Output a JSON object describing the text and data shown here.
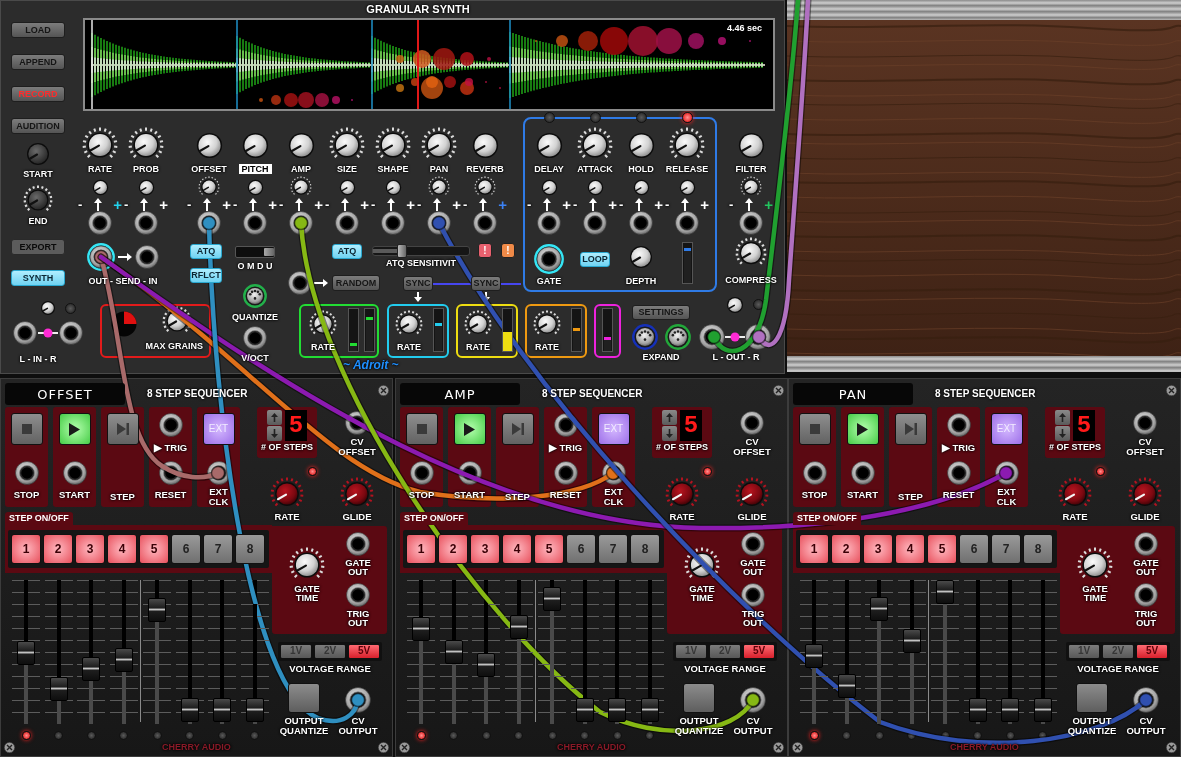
{
  "granular_synth": {
    "title": "GRANULAR SYNTH",
    "side_buttons": [
      {
        "label": "LOAD",
        "kind": "normal"
      },
      {
        "label": "APPEND",
        "kind": "normal"
      },
      {
        "label": "RECORD",
        "kind": "record"
      },
      {
        "label": "AUDITION",
        "kind": "normal"
      }
    ],
    "start_knob": {
      "label": "START"
    },
    "end_knob": {
      "label": "END"
    },
    "export_button": {
      "label": "EXPORT",
      "disabled": true
    },
    "synth_button": {
      "label": "SYNTH",
      "on": true
    },
    "input": {
      "label": "L - IN - R",
      "led": {
        "on": false
      }
    },
    "display": {
      "duration": "4.46 sec"
    },
    "params": [
      {
        "label": "RATE",
        "modulated": true,
        "highlighted": false,
        "cv": {
          "minus": "-",
          "plus": "+",
          "modulated": false,
          "color": "#22d3ee"
        }
      },
      {
        "label": "PROB",
        "modulated": true,
        "highlighted": false,
        "cv": {
          "minus": "-",
          "plus": "+",
          "modulated": false
        }
      },
      {
        "label": "OFFSET",
        "modulated": false,
        "highlighted": false,
        "cv": {
          "minus": "-",
          "plus": "+",
          "modulated": true
        }
      },
      {
        "label": "PITCH",
        "modulated": false,
        "highlighted": true,
        "cv": {
          "minus": "-",
          "plus": "+",
          "modulated": false
        }
      },
      {
        "label": "AMP",
        "modulated": false,
        "highlighted": false,
        "cv": {
          "minus": "-",
          "plus": "+",
          "modulated": true
        }
      },
      {
        "label": "SIZE",
        "modulated": true,
        "highlighted": false,
        "cv": {
          "minus": "-",
          "plus": "+",
          "modulated": false
        }
      },
      {
        "label": "SHAPE",
        "modulated": true,
        "highlighted": false,
        "cv": {
          "minus": "-",
          "plus": "+",
          "modulated": false
        }
      },
      {
        "label": "PAN",
        "modulated": true,
        "highlighted": false,
        "cv": {
          "minus": "-",
          "plus": "+",
          "modulated": true
        }
      },
      {
        "label": "REVERB",
        "modulated": false,
        "highlighted": false,
        "cv": {
          "minus": "-",
          "plus": "+",
          "modulated": true,
          "color": "#3b82f6"
        }
      }
    ],
    "envelope": {
      "stages": [
        {
          "label": "DELAY",
          "modulated": false,
          "highlighted": false,
          "active": false,
          "cv": {
            "minus": "-",
            "plus": "+",
            "modulated": false
          }
        },
        {
          "label": "ATTACK",
          "modulated": true,
          "highlighted": false,
          "active": false,
          "cv": {
            "minus": "-",
            "plus": "+",
            "modulated": false
          }
        },
        {
          "label": "HOLD",
          "modulated": false,
          "highlighted": false,
          "active": false,
          "cv": {
            "minus": "-",
            "plus": "+",
            "modulated": false
          }
        },
        {
          "label": "RELEASE",
          "modulated": true,
          "highlighted": false,
          "active": true,
          "cv": {
            "minus": "-",
            "plus": "+",
            "modulated": false
          }
        }
      ],
      "gate": {
        "label": "GATE",
        "active": true
      },
      "loop": {
        "label": "LOOP",
        "on": true
      },
      "depth": {
        "label": "DEPTH"
      },
      "meter": {
        "level": 0.85
      }
    },
    "filter": {
      "label": "FILTER",
      "modulated": false,
      "highlighted": false,
      "cv": {
        "minus": "-",
        "plus": "+",
        "modulated": true,
        "color": "#22c55e"
      }
    },
    "compress": {
      "label": "COMPRESS",
      "modulated": true
    },
    "send": {
      "label": "OUT - SEND - IN",
      "active": true
    },
    "atq_buttons": [
      {
        "label": "ATQ",
        "on": true
      },
      {
        "label": "RFLCT",
        "on": true
      }
    ],
    "mode_switch": {
      "label": "O M D U",
      "level": 1
    },
    "atq_toggle": {
      "label": "ATQ",
      "on": true
    },
    "atq_sensitivity": {
      "label": "ATQ SENSITIVIT",
      "level": 0.25
    },
    "alerts": [
      {
        "label": "!",
        "color": "#e8606e"
      },
      {
        "label": "!",
        "color": "#f08a48"
      }
    ],
    "random": {
      "label": "RANDOM"
    },
    "sync_buttons": [
      {
        "label": "SYNC"
      },
      {
        "label": "SYNC"
      }
    ],
    "max_grains": {
      "label": "MAX GRAINS",
      "knob": {
        "modulated": true
      }
    },
    "quantize": {
      "label": "QUANTIZE",
      "color": "#22b04a"
    },
    "voct": {
      "label": "V/OCT"
    },
    "lfos": [
      {
        "color": "#22dd33",
        "label": "RATE",
        "meters": [
          {
            "kind": "marker",
            "level": 0.2
          },
          {
            "kind": "marker",
            "level": 0.8
          }
        ]
      },
      {
        "color": "#22ccee",
        "label": "RATE",
        "meters": [
          {
            "kind": "marker",
            "level": 0.65
          }
        ]
      },
      {
        "color": "#eedd11",
        "label": "RATE",
        "meters": [
          {
            "kind": "fill",
            "level": 0.45
          }
        ]
      },
      {
        "color": "#ee9911",
        "label": "RATE",
        "meters": [
          {
            "kind": "marker",
            "level": 0.55
          }
        ]
      },
      {
        "color": "#ee22dd",
        "meters": [
          {
            "kind": "marker",
            "level": 0.35
          }
        ]
      }
    ],
    "brand": "~ Adroit ~",
    "settings": {
      "label": "SETTINGS"
    },
    "expand": {
      "label": "EXPAND",
      "ports": [
        {
          "color": "#1530b8"
        },
        {
          "color": "#22a83a"
        }
      ]
    },
    "output": {
      "label": "L - OUT - R",
      "led": {
        "on": false
      }
    }
  },
  "sequencers": [
    {
      "name": "OFFSET",
      "title": "8 STEP SEQUENCER",
      "transport": [
        {
          "kind": "stop",
          "label": "STOP"
        },
        {
          "kind": "start",
          "label": "START",
          "on": true
        },
        {
          "kind": "step",
          "label": "STEP"
        },
        {
          "kind": "trig",
          "trig_label": "▶ TRIG",
          "label": "RESET"
        },
        {
          "kind": "ext",
          "button": "EXT",
          "label": "EXT CLK",
          "on": true
        }
      ],
      "steps_count": {
        "value": "5",
        "label": "# OF STEPS"
      },
      "cv_offset": {
        "label": "CV OFFSET"
      },
      "clock_led": {
        "on": true
      },
      "rate": {
        "label": "RATE"
      },
      "glide": {
        "label": "GLIDE"
      },
      "step_section": {
        "label": "STEP ON/OFF"
      },
      "step_buttons": [
        {
          "label": "1",
          "on": true
        },
        {
          "label": "2",
          "on": true
        },
        {
          "label": "3",
          "on": true
        },
        {
          "label": "4",
          "on": true
        },
        {
          "label": "5",
          "on": true
        },
        {
          "label": "6",
          "on": false
        },
        {
          "label": "7",
          "on": false
        },
        {
          "label": "8",
          "on": false
        }
      ],
      "gate_time": {
        "label": "GATE TIME"
      },
      "gate_out": {
        "label": "GATE OUT"
      },
      "trig_out": {
        "label": "TRIG OUT"
      },
      "voltage_range": {
        "label": "VOLTAGE RANGE",
        "options": [
          {
            "label": "1V",
            "selected": false
          },
          {
            "label": "2V",
            "selected": false
          },
          {
            "label": "5V",
            "selected": true
          }
        ]
      },
      "output_quantize": {
        "label": "OUTPUT QUANTIZE",
        "on": false
      },
      "cv_output": {
        "label": "CV OUTPUT"
      },
      "faders": [
        {
          "level": 0.49
        },
        {
          "level": 0.19
        },
        {
          "level": 0.36
        },
        {
          "level": 0.43
        },
        {
          "level": 0.85
        },
        {
          "level": 0
        },
        {
          "level": 0
        },
        {
          "level": 0
        }
      ],
      "step_leds": [
        {
          "on": true
        },
        {
          "on": false
        },
        {
          "on": false
        },
        {
          "on": false
        },
        {
          "on": false
        },
        {
          "on": false
        },
        {
          "on": false
        },
        {
          "on": false
        }
      ],
      "brand": "CHERRY AUDIO"
    },
    {
      "name": "AMP",
      "title": "8 STEP SEQUENCER",
      "transport": [
        {
          "kind": "stop",
          "label": "STOP"
        },
        {
          "kind": "start",
          "label": "START",
          "on": true
        },
        {
          "kind": "step",
          "label": "STEP"
        },
        {
          "kind": "trig",
          "trig_label": "▶ TRIG",
          "label": "RESET"
        },
        {
          "kind": "ext",
          "button": "EXT",
          "label": "EXT CLK",
          "on": true
        }
      ],
      "steps_count": {
        "value": "5",
        "label": "# OF STEPS"
      },
      "cv_offset": {
        "label": "CV OFFSET"
      },
      "clock_led": {
        "on": true
      },
      "rate": {
        "label": "RATE"
      },
      "glide": {
        "label": "GLIDE"
      },
      "step_section": {
        "label": "STEP ON/OFF"
      },
      "step_buttons": [
        {
          "label": "1",
          "on": true
        },
        {
          "label": "2",
          "on": true
        },
        {
          "label": "3",
          "on": true
        },
        {
          "label": "4",
          "on": true
        },
        {
          "label": "5",
          "on": true
        },
        {
          "label": "6",
          "on": false
        },
        {
          "label": "7",
          "on": false
        },
        {
          "label": "8",
          "on": false
        }
      ],
      "gate_time": {
        "label": "GATE TIME"
      },
      "gate_out": {
        "label": "GATE OUT"
      },
      "trig_out": {
        "label": "TRIG OUT"
      },
      "voltage_range": {
        "label": "VOLTAGE RANGE",
        "options": [
          {
            "label": "1V",
            "selected": false
          },
          {
            "label": "2V",
            "selected": false
          },
          {
            "label": "5V",
            "selected": true
          }
        ]
      },
      "output_quantize": {
        "label": "OUTPUT QUANTIZE",
        "on": false
      },
      "cv_output": {
        "label": "CV OUTPUT"
      },
      "faders": [
        {
          "level": 0.69
        },
        {
          "level": 0.5
        },
        {
          "level": 0.39
        },
        {
          "level": 0.71
        },
        {
          "level": 0.94
        },
        {
          "level": 0
        },
        {
          "level": 0
        },
        {
          "level": 0
        }
      ],
      "step_leds": [
        {
          "on": true
        },
        {
          "on": false
        },
        {
          "on": false
        },
        {
          "on": false
        },
        {
          "on": false
        },
        {
          "on": false
        },
        {
          "on": false
        },
        {
          "on": false
        }
      ],
      "brand": "CHERRY AUDIO"
    },
    {
      "name": "PAN",
      "title": "8 STEP SEQUENCER",
      "transport": [
        {
          "kind": "stop",
          "label": "STOP"
        },
        {
          "kind": "start",
          "label": "START",
          "on": true
        },
        {
          "kind": "step",
          "label": "STEP"
        },
        {
          "kind": "trig",
          "trig_label": "▶ TRIG",
          "label": "RESET"
        },
        {
          "kind": "ext",
          "button": "EXT",
          "label": "EXT CLK",
          "on": true
        }
      ],
      "steps_count": {
        "value": "5",
        "label": "# OF STEPS"
      },
      "cv_offset": {
        "label": "CV OFFSET"
      },
      "clock_led": {
        "on": true
      },
      "rate": {
        "label": "RATE"
      },
      "glide": {
        "label": "GLIDE"
      },
      "step_section": {
        "label": "STEP ON/OFF"
      },
      "step_buttons": [
        {
          "label": "1",
          "on": true
        },
        {
          "label": "2",
          "on": true
        },
        {
          "label": "3",
          "on": true
        },
        {
          "label": "4",
          "on": true
        },
        {
          "label": "5",
          "on": true
        },
        {
          "label": "6",
          "on": false
        },
        {
          "label": "7",
          "on": false
        },
        {
          "label": "8",
          "on": false
        }
      ],
      "gate_time": {
        "label": "GATE TIME"
      },
      "gate_out": {
        "label": "GATE OUT"
      },
      "trig_out": {
        "label": "TRIG OUT"
      },
      "voltage_range": {
        "label": "VOLTAGE RANGE",
        "options": [
          {
            "label": "1V",
            "selected": false
          },
          {
            "label": "2V",
            "selected": false
          },
          {
            "label": "5V",
            "selected": true
          }
        ]
      },
      "output_quantize": {
        "label": "OUTPUT QUANTIZE",
        "on": false
      },
      "cv_output": {
        "label": "CV OUTPUT"
      },
      "faders": [
        {
          "level": 0.47
        },
        {
          "level": 0.22
        },
        {
          "level": 0.86
        },
        {
          "level": 0.59
        },
        {
          "level": 1
        },
        {
          "level": 0
        },
        {
          "level": 0
        },
        {
          "level": 0
        }
      ],
      "step_leds": [
        {
          "on": true
        },
        {
          "on": false
        },
        {
          "on": false
        },
        {
          "on": false
        },
        {
          "on": false
        },
        {
          "on": false
        },
        {
          "on": false
        },
        {
          "on": false
        }
      ],
      "brand": "CHERRY AUDIO"
    }
  ]
}
